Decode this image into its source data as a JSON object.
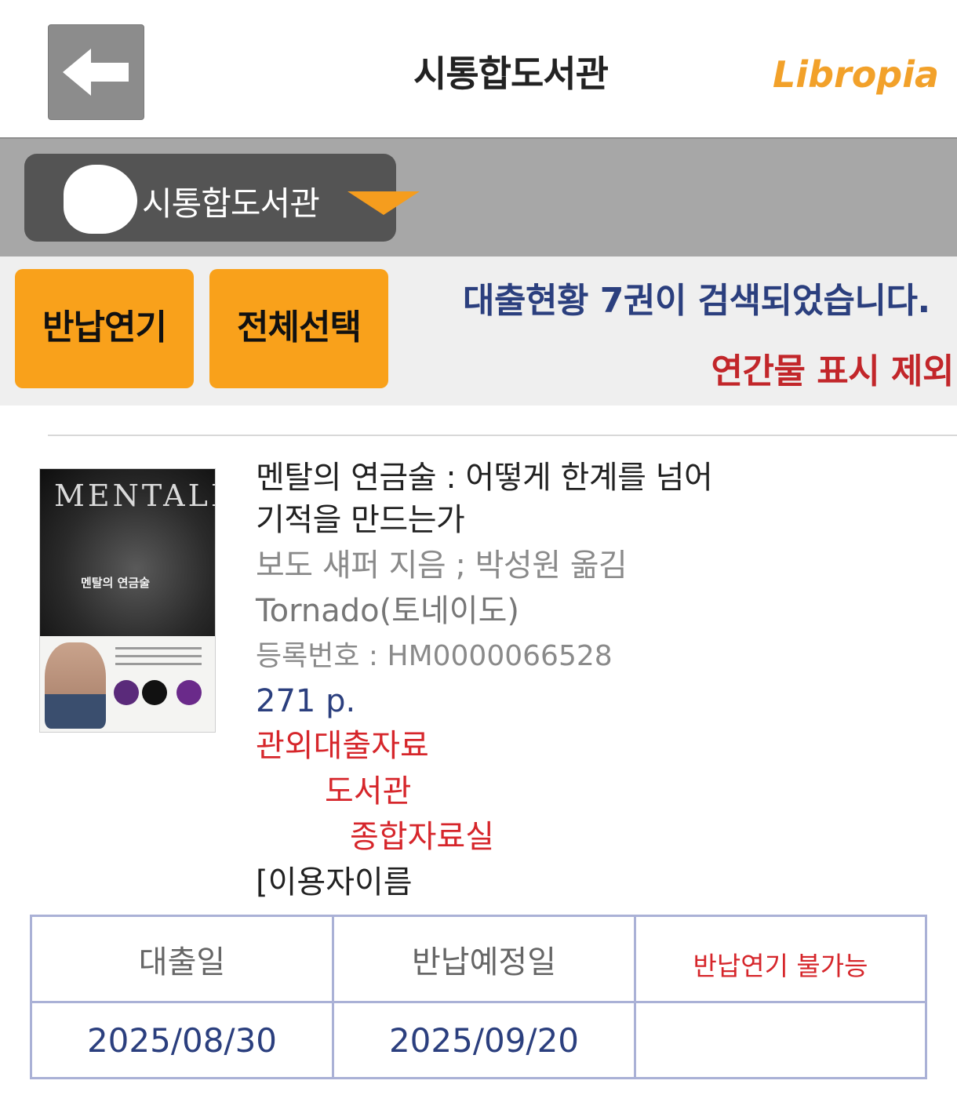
{
  "header": {
    "back_icon": "arrow-left-icon",
    "title": "시통합도서관",
    "logo": "Libropia"
  },
  "library_selector": {
    "label": "시통합도서관",
    "dropdown_icon": "triangle-down-icon"
  },
  "actions": {
    "extend_label": "반납연기",
    "select_all_label": "전체선택",
    "result_count": "대출현황 7권이 검색되었습니다.",
    "exclude_serials": "연간물 표시 제외"
  },
  "book": {
    "cover_title": "MENTALE",
    "cover_subtitle": "멘탈의 연금술",
    "title_line1": "멘탈의 연금술 : 어떻게 한계를 넘어",
    "title_line2": "기적을 만드는가",
    "author": "보도 섀퍼 지음 ; 박성원 옮김",
    "publisher": "Tornado(토네이도)",
    "reg_no": "등록번호 : HM0000066528",
    "pages": "271 p.",
    "loan_type": "관외대출자료",
    "library": "도서관",
    "room": "종합자료실",
    "user": "[이용자이름"
  },
  "loan_table": {
    "loan_date_header": "대출일",
    "due_date_header": "반납예정일",
    "extend_status": "반납연기 불가능",
    "loan_date": "2025/08/30",
    "due_date": "2025/09/20"
  },
  "colors": {
    "accent_orange": "#f9a11b",
    "navy_text": "#2b3f7e",
    "red_text": "#d6262b",
    "bar_gray": "#a7a7a7"
  }
}
